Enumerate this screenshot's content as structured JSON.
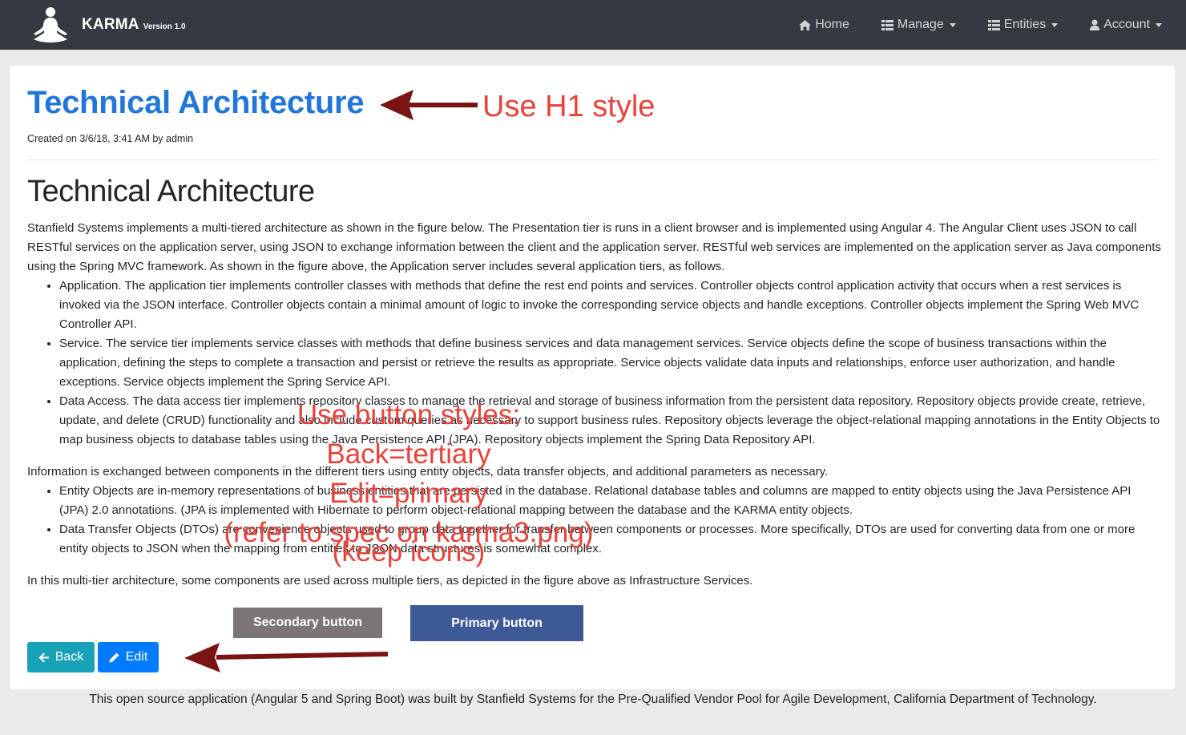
{
  "navbar": {
    "brand": "KARMA",
    "version": "Version 1.0",
    "items": [
      {
        "label": "Home",
        "icon": "home-icon",
        "dropdown": false
      },
      {
        "label": "Manage",
        "icon": "list-icon",
        "dropdown": true
      },
      {
        "label": "Entities",
        "icon": "list-icon",
        "dropdown": true
      },
      {
        "label": "Account",
        "icon": "user-icon",
        "dropdown": true
      }
    ]
  },
  "page": {
    "title": "Technical Architecture",
    "created": "Created on 3/6/18, 3:41 AM by admin",
    "heading": "Technical Architecture",
    "intro": "Stanfield Systems implements a multi-tiered architecture as shown in the figure below. The Presentation tier is runs in a client browser and is implemented using Angular 4. The Angular Client uses JSON to call RESTful services on the application server, using JSON to exchange information between the client and the application server. RESTful web services are implemented on the application server as Java components using the Spring MVC framework. As shown in the figure above, the Application server includes several application tiers, as follows.",
    "tiers": [
      "Application. The application tier implements controller classes with methods that define the rest end points and services. Controller objects control application activity that occurs when a rest services is invoked via the JSON interface. Controller objects contain a minimal amount of logic to invoke the corresponding service objects and handle exceptions. Controller objects implement the Spring Web MVC Controller API.",
      "Service. The service tier implements service classes with methods that define business services and data management services. Service objects define the scope of business transactions within the application, defining the steps to complete a transaction and persist or retrieve the results as appropriate. Service objects validate data inputs and relationships, enforce user authorization, and handle exceptions. Service objects implement the Spring Service API.",
      "Data Access. The data access tier implements repository classes to manage the retrieval and storage of business information from the persistent data repository. Repository objects provide create, retrieve, update, and delete (CRUD) functionality and also include custom queries as necessary to support business rules. Repository objects leverage the object-relational mapping annotations in the Entity Objects to map business objects to database tables using the Java Persistence API (JPA). Repository objects implement the Spring Data Repository API."
    ],
    "exchange": "Information is exchanged between components in the different tiers using entity objects, data transfer objects, and additional parameters as necessary.",
    "objects": [
      "Entity Objects are in-memory representations of business entities that are persisted in the database. Relational database tables and columns are mapped to entity objects using the Java Persistence API (JPA) 2.0 annotations. (JPA is implemented with Hibernate to perform object-relational mapping between the database and the KARMA entity objects.",
      "Data Transfer Objects (DTOs) are convenience objects used to group data together for transfer between components or processes. More specifically, DTOs are used for converting data from one or more entity objects to JSON when the mapping from entities to JSON data structures is somewhat complex."
    ],
    "closing": "In this multi-tier architecture, some components are used across multiple tiers, as depicted in the figure above as Infrastructure Services.",
    "back_label": "Back",
    "edit_label": "Edit"
  },
  "footer": {
    "text": "This open source application (Angular 5 and Spring Boot) was built by Stanfield Systems for the Pre-Qualified Vendor Pool for Agile Development, California Department of Technology."
  },
  "annotations": {
    "h1_note": "Use H1 style",
    "button_note": [
      "Use button styles:",
      "Back=tertiary",
      "Edit=primary",
      "(refer to spec on karma3.png)",
      "(keep icons)"
    ],
    "secondary_sample": "Secondary button",
    "primary_sample": "Primary button",
    "text_color": "#e8423a",
    "arrow_color": "#7a1414"
  },
  "colors": {
    "navbar": "#343a40",
    "title": "#2176d9",
    "back_button": "#17a2b8",
    "edit_button": "#007bff",
    "secondary_sample": "#7b7575",
    "primary_sample": "#3e5a96"
  }
}
